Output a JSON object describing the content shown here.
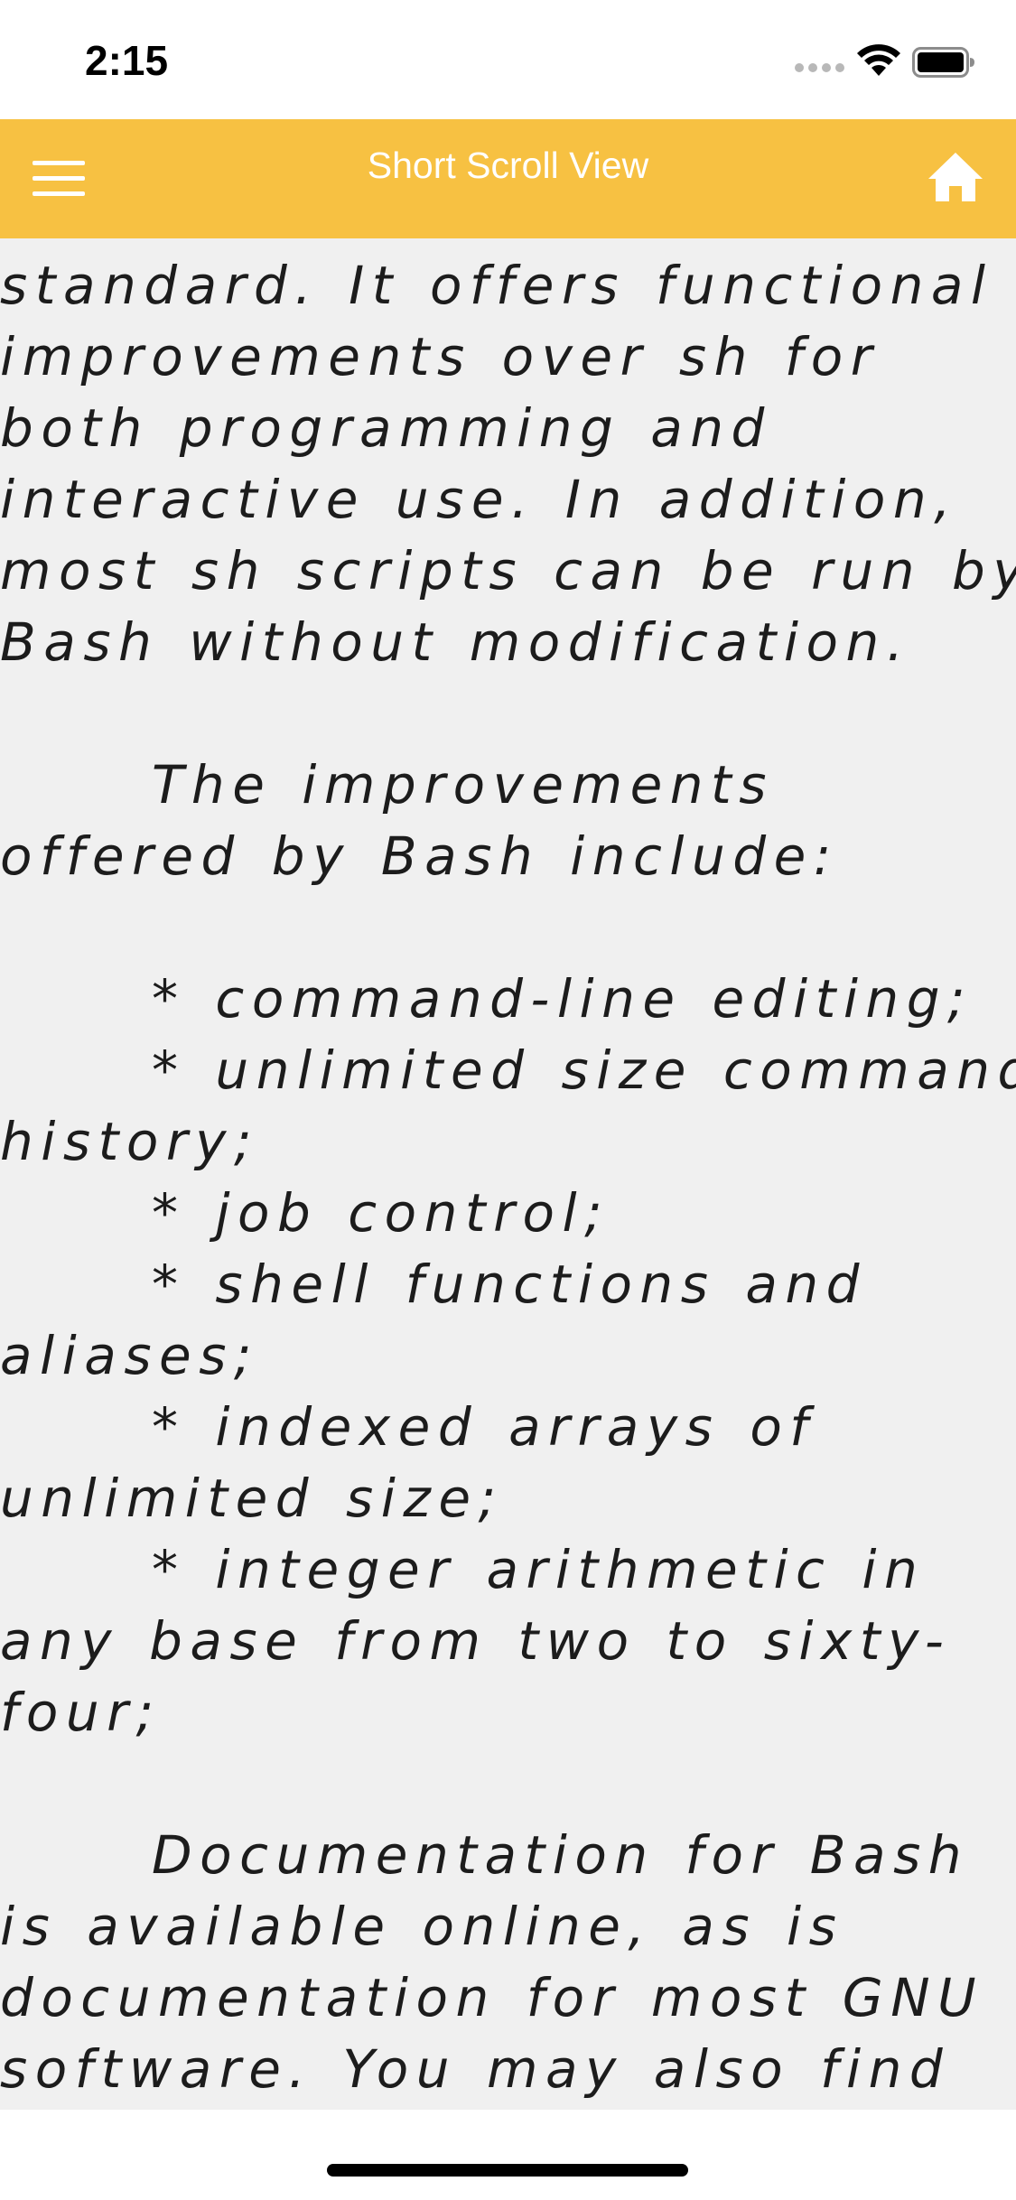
{
  "status_bar": {
    "time": "2:15"
  },
  "nav": {
    "title": "Short Scroll View",
    "menu_icon": "hamburger-menu-icon",
    "home_icon": "home-icon"
  },
  "content": {
    "lines": [
      "standard. It offers functional",
      "improvements over sh for",
      "both programming and",
      "interactive use. In addition,",
      "most sh scripts can be run by",
      "Bash without modification.",
      "",
      "\tThe improvements",
      "offered by Bash include:",
      "",
      "\t* command-line editing;",
      "\t* unlimited size command",
      "history;",
      "\t* job control;",
      "\t* shell functions and",
      "aliases;",
      "\t* indexed arrays of",
      "unlimited size;",
      "\t* integer arithmetic in",
      "any base from two to sixty-",
      "four;",
      "",
      "\tDocumentation for Bash",
      "is available online, as is",
      "documentation for most GNU",
      "software. You may also find"
    ]
  },
  "colors": {
    "nav_background": "#f7c142",
    "content_background": "#f0f0f0",
    "text": "#1c1c1c"
  }
}
